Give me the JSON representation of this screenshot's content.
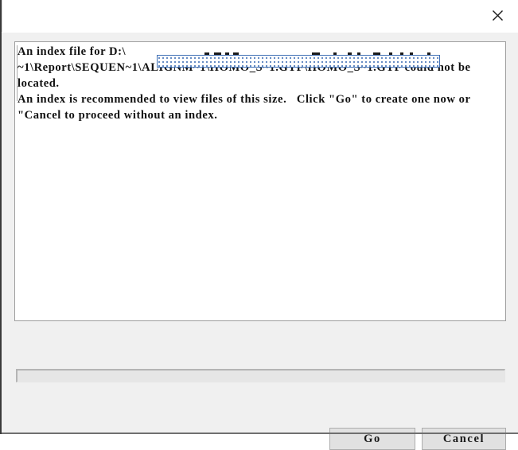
{
  "window": {
    "title": "",
    "close_icon": "close-x-icon"
  },
  "message": {
    "line1_prefix": "An index file for D:\\",
    "obscured_path_segment": "",
    "full_text": "An index file for D:\\\n~1\\Report\\SEQUEN~1\\ALIGNM~1\\HOMO_S~1.GTF\\HOMO_S~1.GTF could not be located.\nAn index is recommended to view files of this size.   Click \"Go\" to create one now or \"Cancel to proceed without an index."
  },
  "progress": {
    "value": 0,
    "label": ""
  },
  "buttons": {
    "go_label": "Go",
    "cancel_label": "Cancel"
  },
  "colors": {
    "dialog_background": "#f0f0f0",
    "textbox_background": "#ffffff",
    "button_face": "#e1e1e1",
    "button_border": "#adadad",
    "selection_border": "#3f6fb5",
    "text": "#121212",
    "progress_track": "#e6e6e6"
  }
}
